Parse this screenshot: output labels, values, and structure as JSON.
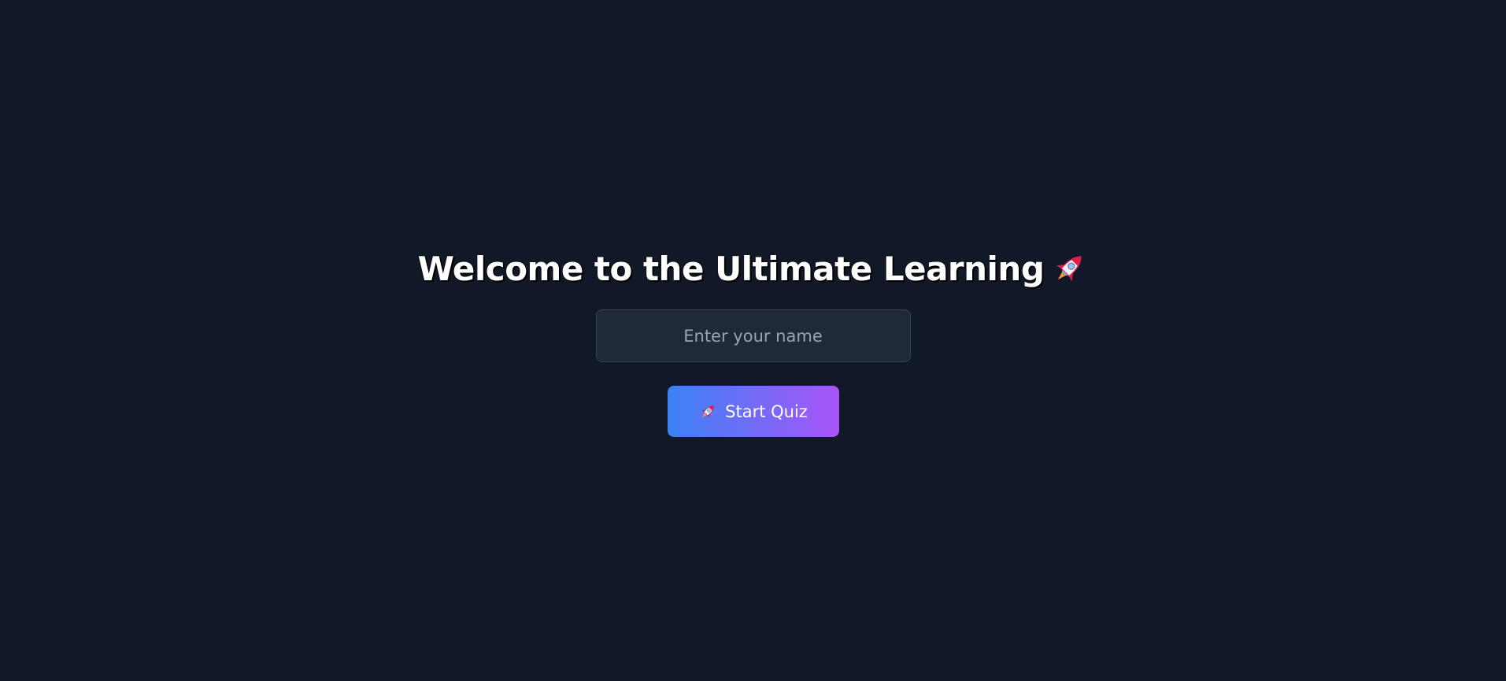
{
  "welcome": {
    "title": "Welcome to the Ultimate Learning",
    "title_icon": "rocket-icon",
    "name_input": {
      "placeholder": "Enter your name",
      "value": ""
    },
    "start_button": {
      "icon": "rocket-icon",
      "label": "Start Quiz"
    }
  },
  "colors": {
    "background": "#111827",
    "input_background": "#1f2937",
    "input_border": "#374151",
    "button_gradient_start": "#3b82f6",
    "button_gradient_end": "#a855f7",
    "text": "#ffffff",
    "placeholder": "#9ca3af"
  }
}
